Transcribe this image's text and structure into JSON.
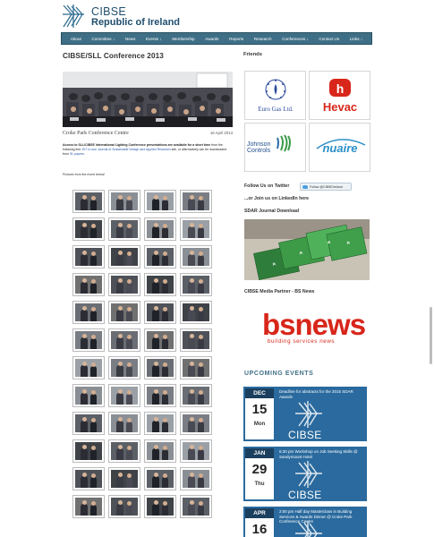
{
  "header": {
    "org_line1": "CIBSE",
    "org_line2": "Republic of Ireland"
  },
  "nav": {
    "items": [
      "About",
      "Committee ↓",
      "News",
      "Events ↓",
      "Membership",
      "Awards",
      "Reports",
      "Research",
      "Conferences ↓",
      "Contact Us",
      "Links ↓"
    ]
  },
  "article": {
    "title": "CIBSE/SLL Conference 2013",
    "caption": "Croke Park Conference Centre",
    "date": "16 April 2013",
    "intro_bold": "Access to SLL/CIBSE International Lighting Conference presentations are available for a short time",
    "intro_mid": " from the following link: ",
    "intro_link1": "DIT e-now Journal of Sustainable Design and Applied Research",
    "intro_tail": " site, or alternatively can be downloaded from ",
    "intro_link2": "SL papers",
    "intro_end": ".",
    "pictures_label": "Pictures from the event below!"
  },
  "sidebar": {
    "friends_heading": "Friends",
    "friends": [
      "Euro Gas Ltd.",
      "Hevac",
      "Johnson Controls",
      "nuaire"
    ],
    "follow_label": "Follow Us on Twitter",
    "twitter_button": "Follow @CIBSEIreland",
    "linkedin_label": "...or Join us on LinkedIn here",
    "sdar_heading": "SDAR Journal Download",
    "media_heading": "CIBSE Media Partner - BS News",
    "bs_main": "bsnews",
    "bs_sub": "building services news",
    "events_heading": "UPCOMING EVENTS",
    "events": [
      {
        "month": "DEC",
        "day": "15",
        "dow": "Mon",
        "text": "Deadline for abstracts for the 2015 SDAR Awards"
      },
      {
        "month": "JAN",
        "day": "29",
        "dow": "Thu",
        "text": "6:30 pm Workshop on Job Seeking Skills @ Sandymount Hotel"
      },
      {
        "month": "APR",
        "day": "16",
        "dow": "",
        "text": "2:00 pm Half day Masterclass in Building Services & Awards Dinner @ Croke Park Conference Centre"
      }
    ],
    "event_logo_text": "CIBSE"
  },
  "thumbnails": {
    "count": 48
  },
  "colors": {
    "nav_bg": "#3f6f86",
    "event_bg": "#2a6a9e",
    "brand_red": "#d8261a",
    "link": "#2858a8"
  }
}
